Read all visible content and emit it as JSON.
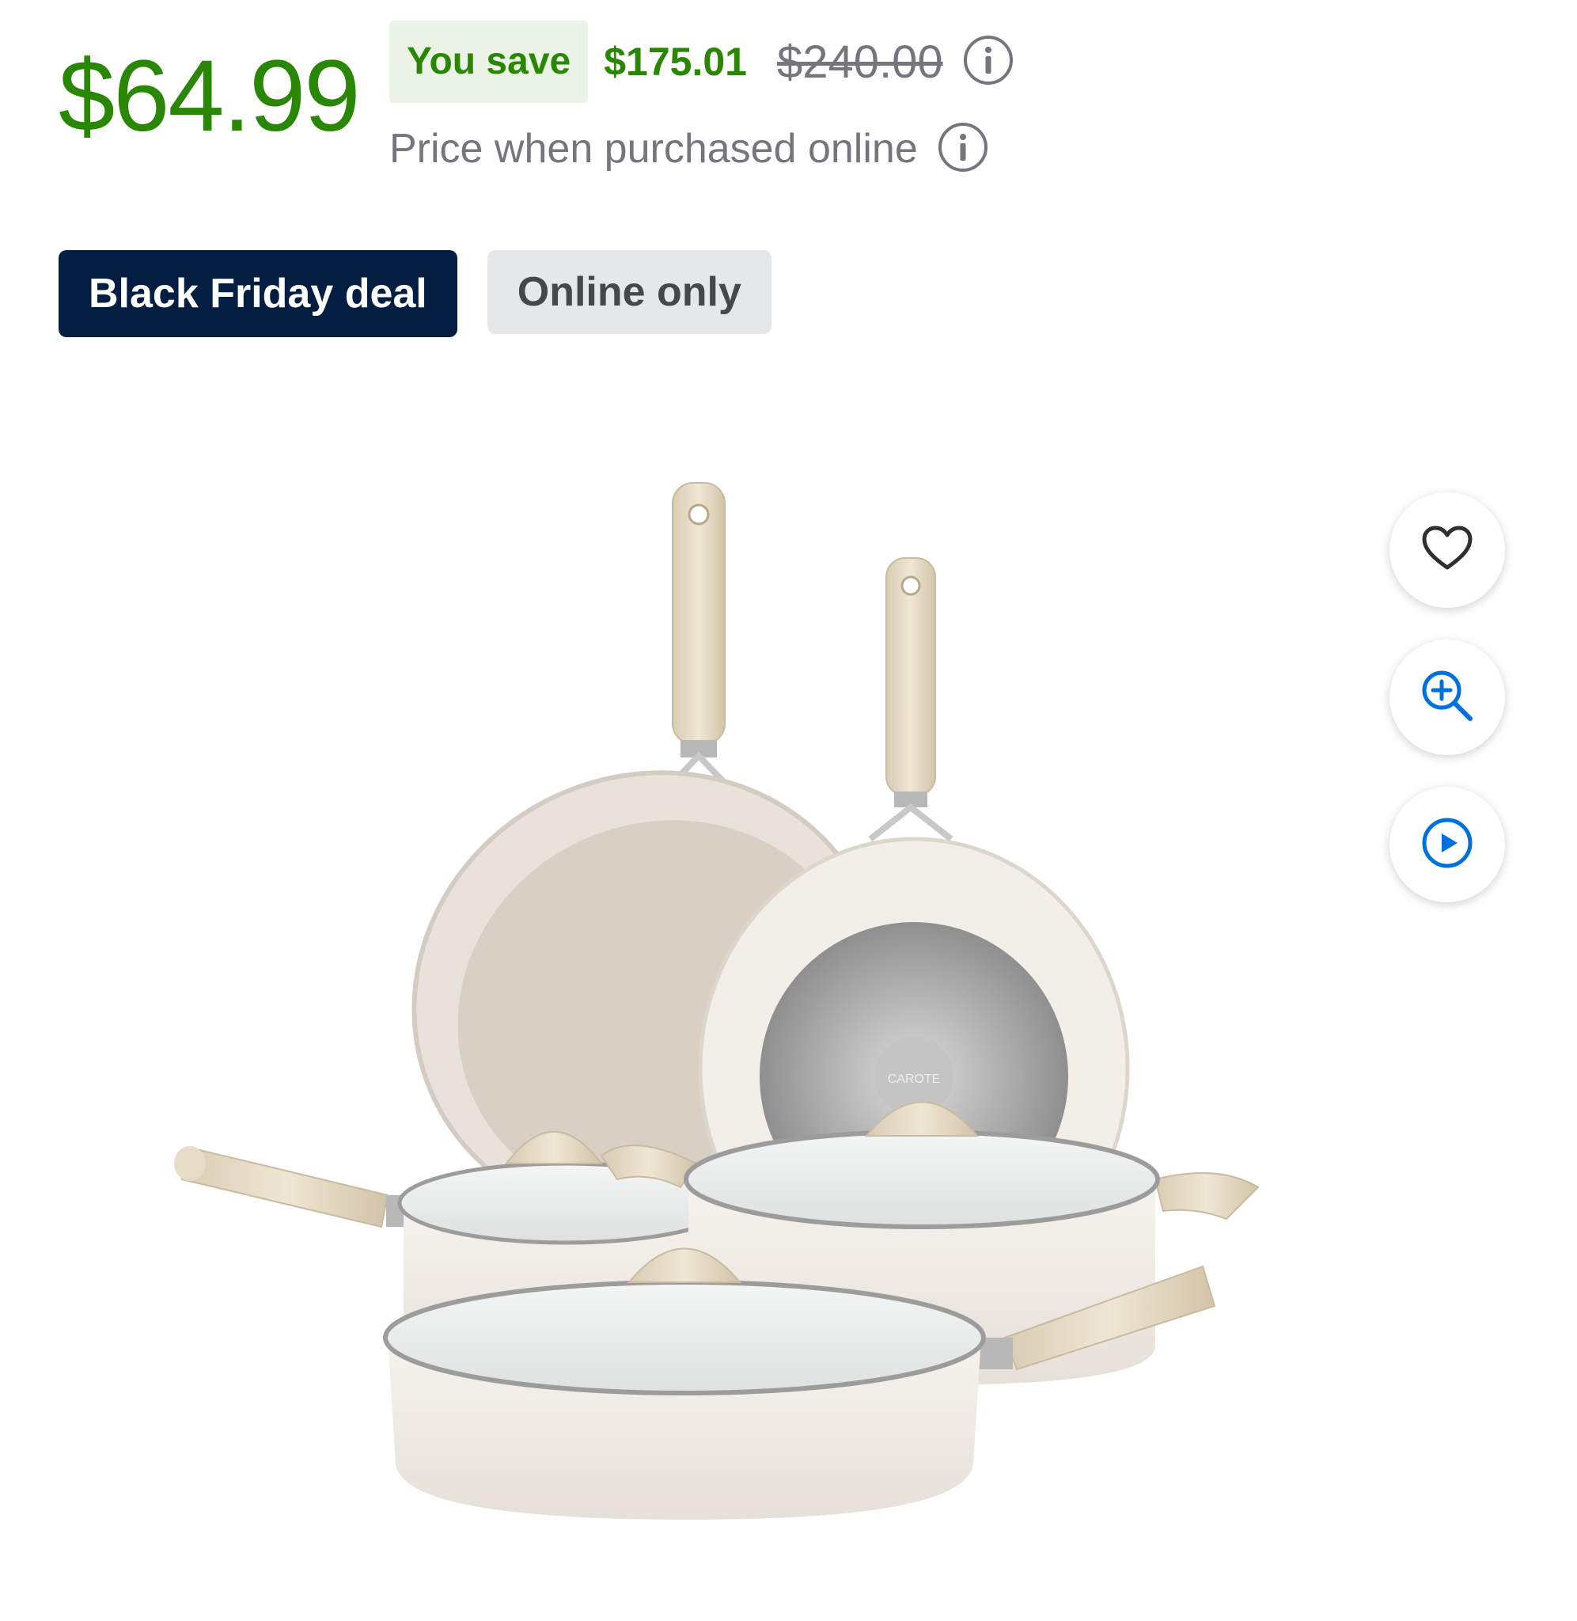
{
  "price": {
    "current": "$64.99",
    "save_label": "You save",
    "save_amount": "$175.01",
    "was_price": "$240.00",
    "subtext": "Price when purchased online"
  },
  "badges": {
    "deal": "Black Friday deal",
    "online": "Online only"
  },
  "product_image": {
    "brand_mark": "CAROTE",
    "description_icon": "cookware-set-image"
  },
  "actions": {
    "favorite_icon": "heart-icon",
    "zoom_icon": "zoom-in-icon",
    "video_icon": "play-icon"
  },
  "colors": {
    "price_green": "#2a8703",
    "deal_navy": "#041e42",
    "action_blue": "#0071dc"
  }
}
